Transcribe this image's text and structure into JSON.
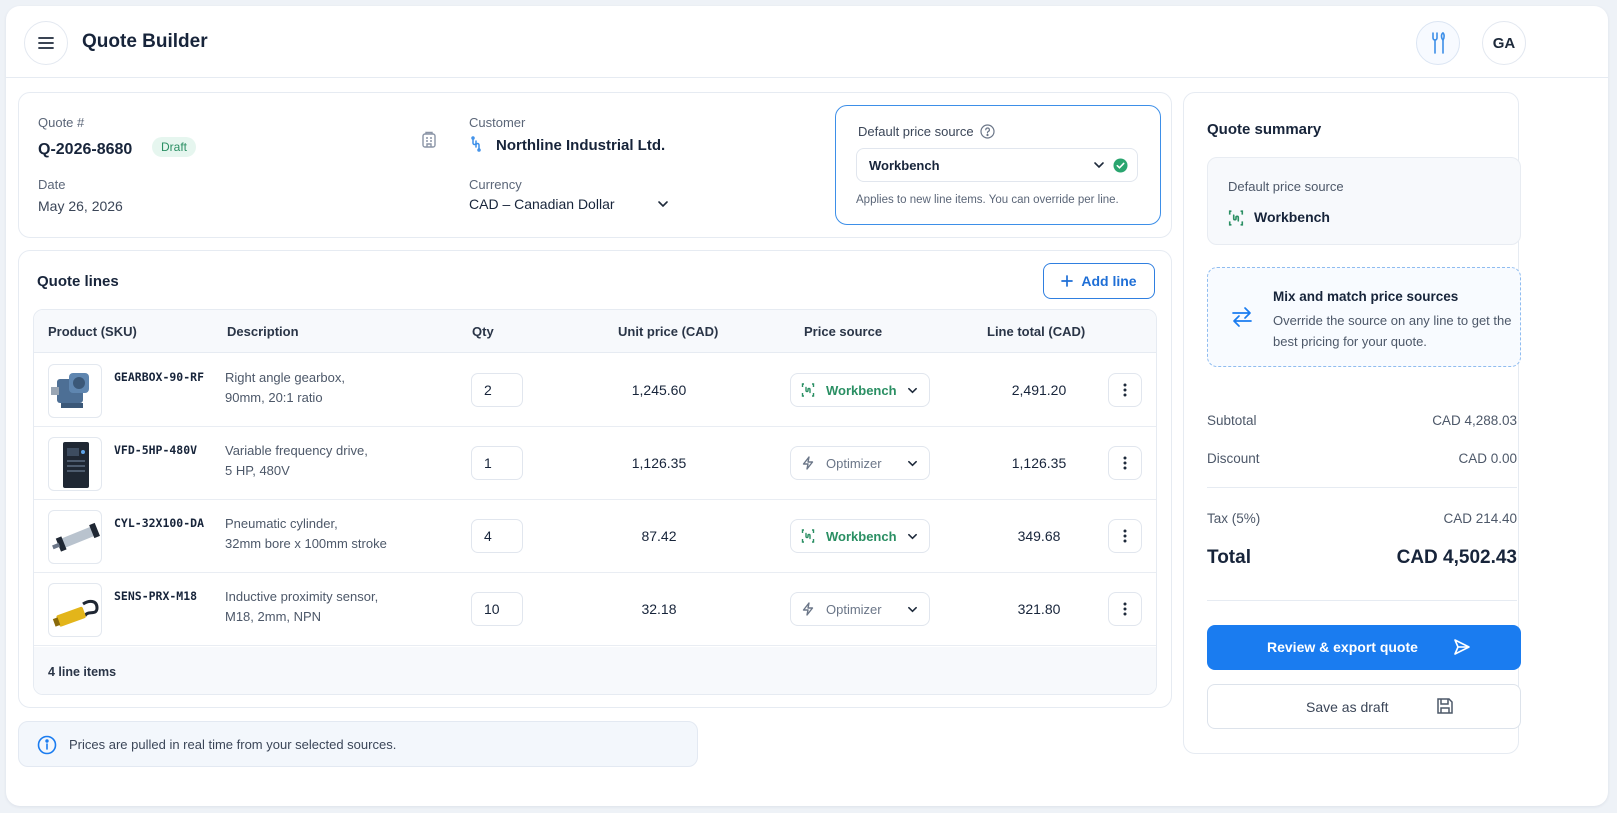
{
  "header": {
    "title": "Quote Builder",
    "avatar_initials": "GA",
    "icons": {
      "menu": "menu-icon",
      "tools": "tools-icon"
    }
  },
  "quote": {
    "number_label": "Quote #",
    "number": "Q-2026-8680",
    "status": "Draft",
    "date_label": "Date",
    "date": "May 26, 2026",
    "customer_label": "Customer",
    "customer": "Northline Industrial Ltd.",
    "currency_label": "Currency",
    "currency": "CAD – Canadian Dollar"
  },
  "default_price_source": {
    "title": "Default price source",
    "value": "Workbench",
    "note": "Applies to new line items. You can override per line."
  },
  "lines": {
    "title": "Quote lines",
    "add_label": "Add line",
    "columns": [
      "Product (SKU)",
      "Description",
      "Qty",
      "Unit price (CAD)",
      "Price source",
      "Line total (CAD)"
    ],
    "rows": [
      {
        "sku": "GEARBOX-90-RF",
        "desc1": "Right angle gearbox,",
        "desc2": "90mm, 20:1 ratio",
        "qty": "2",
        "unit": "1,245.60",
        "source": "Workbench",
        "total": "2,491.20"
      },
      {
        "sku": "VFD-5HP-480V",
        "desc1": "Variable frequency drive,",
        "desc2": "5 HP, 480V",
        "qty": "1",
        "unit": "1,126.35",
        "source": "Optimizer",
        "total": "1,126.35"
      },
      {
        "sku": "CYL-32X100-DA",
        "desc1": "Pneumatic cylinder,",
        "desc2": "32mm bore x 100mm stroke",
        "qty": "4",
        "unit": "87.42",
        "source": "Workbench",
        "total": "349.68"
      },
      {
        "sku": "SENS-PRX-M18",
        "desc1": "Inductive proximity sensor,",
        "desc2": "M18, 2mm, NPN",
        "qty": "10",
        "unit": "32.18",
        "source": "Optimizer",
        "total": "321.80"
      }
    ],
    "footer": "4 line items"
  },
  "info": "Prices are pulled in real time from your selected sources.",
  "summary": {
    "title": "Quote summary",
    "dps_label": "Default price source",
    "dps_value": "Workbench",
    "mix_title": "Mix and match price sources",
    "mix_desc": "Override the source on any line to get the best pricing for your quote.",
    "subtotal_label": "Subtotal",
    "subtotal": "CAD 4,288.03",
    "discount_label": "Discount",
    "discount": "CAD 0.00",
    "tax_label": "Tax (5%)",
    "tax": "CAD 214.40",
    "total_label": "Total",
    "total": "CAD 4,502.43",
    "review_label": "Review & export quote",
    "save_label": "Save as draft"
  },
  "colors": {
    "accent": "#1a7cf0",
    "workbench": "#2a8f63",
    "optimizer": "#6b7688"
  }
}
